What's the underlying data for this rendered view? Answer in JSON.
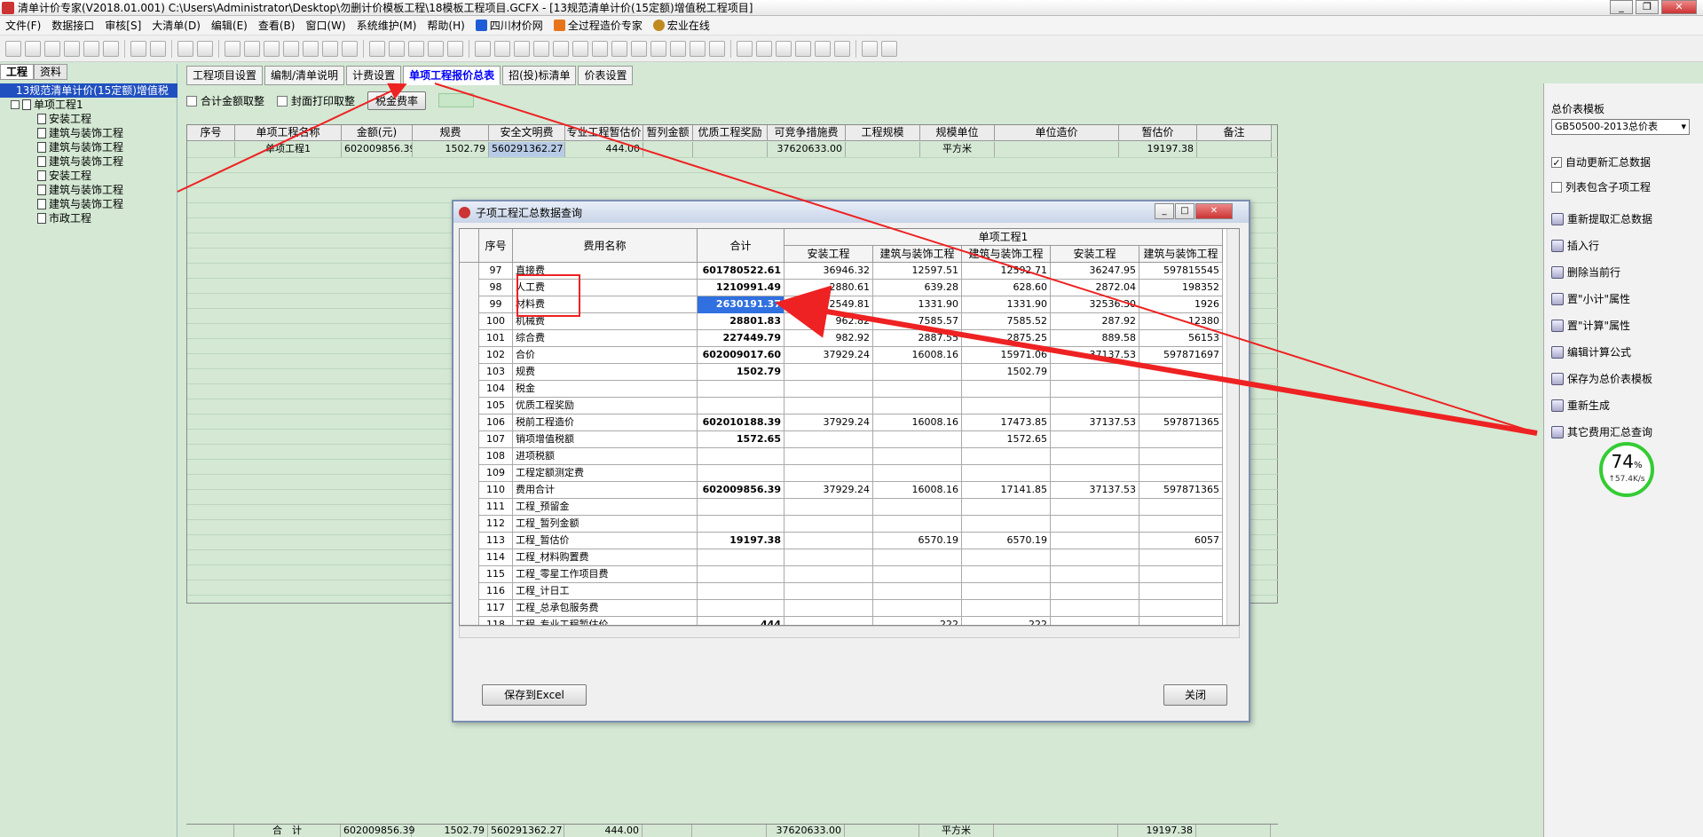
{
  "window": {
    "title": "清单计价专家(V2018.01.001) C:\\Users\\Administrator\\Desktop\\勿删计价模板工程\\18模板工程项目.GCFX - [13规范清单计价(15定额)增值税工程项目]",
    "minimize": "_",
    "restore": "❐",
    "close": "✕"
  },
  "menu": {
    "items": [
      "文件(F)",
      "数据接口",
      "审核[S]",
      "大清单(D)",
      "编辑(E)",
      "查看(B)",
      "窗口(W)",
      "系统维护(M)",
      "帮助(H)"
    ],
    "ext": [
      {
        "label": "四川材价网",
        "color": "#1e5bd6"
      },
      {
        "label": "全过程造价专家",
        "color": "#e8741a"
      },
      {
        "label": "宏业在线",
        "color": "#c08a20"
      }
    ]
  },
  "left": {
    "tabs": [
      "工程",
      "资料"
    ],
    "root": "13规范清单计价(15定额)增值税",
    "project": "单项工程1",
    "children": [
      "安装工程",
      "建筑与装饰工程",
      "建筑与装饰工程",
      "建筑与装饰工程",
      "安装工程",
      "建筑与装饰工程",
      "建筑与装饰工程",
      "市政工程"
    ]
  },
  "main": {
    "tabs": [
      "工程项目设置",
      "编制/清单说明",
      "计费设置",
      "单项工程报价总表",
      "招(投)标清单",
      "价表设置"
    ],
    "active_tab": 3,
    "opt_total": "合计金额取整",
    "opt_cover": "封面打印取整",
    "rate_btn": "税金费率",
    "columns": [
      "序号",
      "单项工程名称",
      "金额(元)",
      "规费",
      "安全文明费",
      "专业工程暂估价",
      "暂列金额",
      "优质工程奖励",
      "可竞争措施费",
      "工程规模",
      "规模单位",
      "单位造价",
      "暂估价",
      "备注"
    ],
    "row": [
      "",
      "单项工程1",
      "602009856.39",
      "1502.79",
      "560291362.27",
      "444.00",
      "",
      "",
      "37620633.00",
      "",
      "平方米",
      "",
      "19197.38",
      ""
    ],
    "total": [
      "",
      "合　计",
      "602009856.39",
      "1502.79",
      "560291362.27",
      "444.00",
      "",
      "",
      "37620633.00",
      "",
      "平方米",
      "",
      "19197.38",
      ""
    ]
  },
  "right": {
    "template_label": "总价表模板",
    "template_value": "GB50500-2013总价表",
    "chk_auto": "自动更新汇总数据",
    "chk_sub": "列表包含子项工程",
    "actions": [
      "重新提取汇总数据",
      "插入行",
      "删除当前行",
      "置\"小计\"属性",
      "置\"计算\"属性",
      "编辑计算公式",
      "保存为总价表模板",
      "重新生成",
      "其它费用汇总查询"
    ],
    "gauge_pct": "74",
    "gauge_unit": "%",
    "gauge_speed": "↑57.4K/s"
  },
  "dialog": {
    "title": "子项工程汇总数据查询",
    "h_seq": "序号",
    "h_name": "费用名称",
    "h_total": "合计",
    "h_group": "单项工程1",
    "sub": [
      "安装工程",
      "建筑与装饰工程",
      "建筑与装饰工程",
      "安装工程",
      "建筑与装饰工程"
    ],
    "rows": [
      [
        "97",
        "直接费",
        "601780522.61",
        "36946.32",
        "12597.51",
        "12592.71",
        "36247.95",
        "597815545"
      ],
      [
        "98",
        "人工费",
        "1210991.49",
        "2880.61",
        "639.28",
        "628.60",
        "2872.04",
        "198352"
      ],
      [
        "99",
        "材料费",
        "2630191.37",
        "32549.81",
        "1331.90",
        "1331.90",
        "32536.30",
        "1926"
      ],
      [
        "100",
        "机械费",
        "28801.83",
        "962.82",
        "7585.57",
        "7585.52",
        "287.92",
        "12380"
      ],
      [
        "101",
        "综合费",
        "227449.79",
        "982.92",
        "2887.55",
        "2875.25",
        "889.58",
        "56153"
      ],
      [
        "102",
        "合价",
        "602009017.60",
        "37929.24",
        "16008.16",
        "15971.06",
        "37137.53",
        "597871697"
      ],
      [
        "103",
        "规费",
        "1502.79",
        "",
        "",
        "1502.79",
        "",
        ""
      ],
      [
        "104",
        "税金",
        "",
        "",
        "",
        "",
        "",
        ""
      ],
      [
        "105",
        "优质工程奖励",
        "",
        "",
        "",
        "",
        "",
        ""
      ],
      [
        "106",
        "税前工程造价",
        "602010188.39",
        "37929.24",
        "16008.16",
        "17473.85",
        "37137.53",
        "597871365"
      ],
      [
        "107",
        "销项增值税额",
        "1572.65",
        "",
        "",
        "1572.65",
        "",
        ""
      ],
      [
        "108",
        "进项税额",
        "",
        "",
        "",
        "",
        "",
        ""
      ],
      [
        "109",
        "工程定额测定费",
        "",
        "",
        "",
        "",
        "",
        ""
      ],
      [
        "110",
        "费用合计",
        "602009856.39",
        "37929.24",
        "16008.16",
        "17141.85",
        "37137.53",
        "597871365"
      ],
      [
        "111",
        "工程_预留金",
        "",
        "",
        "",
        "",
        "",
        ""
      ],
      [
        "112",
        "工程_暂列金额",
        "",
        "",
        "",
        "",
        "",
        ""
      ],
      [
        "113",
        "工程_暂估价",
        "19197.38",
        "",
        "6570.19",
        "6570.19",
        "",
        "6057"
      ],
      [
        "114",
        "工程_材料购置费",
        "",
        "",
        "",
        "",
        "",
        ""
      ],
      [
        "115",
        "工程_零星工作项目费",
        "",
        "",
        "",
        "",
        "",
        ""
      ],
      [
        "116",
        "工程_计日工",
        "",
        "",
        "",
        "",
        "",
        ""
      ],
      [
        "117",
        "工程_总承包服务费",
        "",
        "",
        "",
        "",
        "",
        ""
      ],
      [
        "118",
        "工程_专业工程暂估价",
        "444",
        "",
        "222",
        "222",
        "",
        ""
      ]
    ],
    "btn_excel": "保存到Excel",
    "btn_close": "关闭"
  }
}
